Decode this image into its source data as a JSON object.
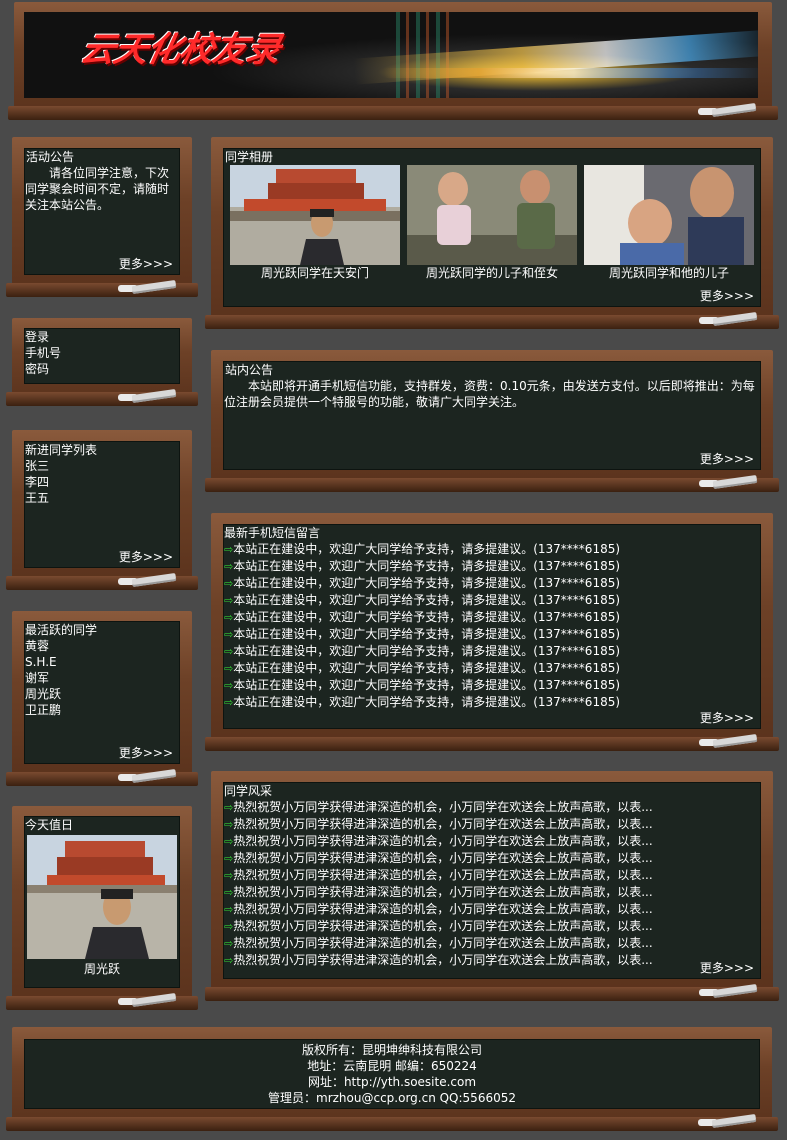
{
  "site": {
    "title": "云天化校友录"
  },
  "notice": {
    "title": "活动公告",
    "text": "请各位同学注意，下次同学聚会时间不定，请随时关注本站公告。",
    "more": "更多>>>"
  },
  "login": {
    "title": "登录",
    "phone_label": "手机号",
    "password_label": "密码"
  },
  "new_members": {
    "title": "新进同学列表",
    "items": [
      "张三",
      "李四",
      "王五"
    ],
    "more": "更多>>>"
  },
  "active": {
    "title": "最活跃的同学",
    "items": [
      "黄蓉",
      "S.H.E",
      "谢军",
      "周光跃",
      "卫正鹏"
    ],
    "more": "更多>>>"
  },
  "duty": {
    "title": "今天值日",
    "name": "周光跃"
  },
  "album": {
    "title": "同学相册",
    "photos": [
      {
        "caption": "周光跃同学在天安门"
      },
      {
        "caption": "周光跃同学的儿子和侄女"
      },
      {
        "caption": "周光跃同学和他的儿子"
      }
    ],
    "more": "更多>>>"
  },
  "site_notice": {
    "title": "站内公告",
    "text": "本站即将开通手机短信功能，支持群发，资费：0.10元条，由发送方支付。以后即将推出：为每位注册会员提供一个特服号的功能，敬请广大同学关注。",
    "more": "更多>>>"
  },
  "sms": {
    "title": "最新手机短信留言",
    "messages": [
      "本站正在建设中，欢迎广大同学给予支持，请多提建议。(137****6185)",
      "本站正在建设中，欢迎广大同学给予支持，请多提建议。(137****6185)",
      "本站正在建设中，欢迎广大同学给予支持，请多提建议。(137****6185)",
      "本站正在建设中，欢迎广大同学给予支持，请多提建议。(137****6185)",
      "本站正在建设中，欢迎广大同学给予支持，请多提建议。(137****6185)",
      "本站正在建设中，欢迎广大同学给予支持，请多提建议。(137****6185)",
      "本站正在建设中，欢迎广大同学给予支持，请多提建议。(137****6185)",
      "本站正在建设中，欢迎广大同学给予支持，请多提建议。(137****6185)",
      "本站正在建设中，欢迎广大同学给予支持，请多提建议。(137****6185)",
      "本站正在建设中，欢迎广大同学给予支持，请多提建议。(137****6185)"
    ],
    "more": "更多>>>"
  },
  "style": {
    "title": "同学风采",
    "items": [
      "热烈祝贺小万同学获得进津深造的机会，小万同学在欢送会上放声高歌，以表...",
      "热烈祝贺小万同学获得进津深造的机会，小万同学在欢送会上放声高歌，以表...",
      "热烈祝贺小万同学获得进津深造的机会，小万同学在欢送会上放声高歌，以表...",
      "热烈祝贺小万同学获得进津深造的机会，小万同学在欢送会上放声高歌，以表...",
      "热烈祝贺小万同学获得进津深造的机会，小万同学在欢送会上放声高歌，以表...",
      "热烈祝贺小万同学获得进津深造的机会，小万同学在欢送会上放声高歌，以表...",
      "热烈祝贺小万同学获得进津深造的机会，小万同学在欢送会上放声高歌，以表...",
      "热烈祝贺小万同学获得进津深造的机会，小万同学在欢送会上放声高歌，以表...",
      "热烈祝贺小万同学获得进津深造的机会，小万同学在欢送会上放声高歌，以表...",
      "热烈祝贺小万同学获得进津深造的机会，小万同学在欢送会上放声高歌，以表..."
    ],
    "more": "更多>>>"
  },
  "footer": {
    "copyright": "版权所有：昆明坤绅科技有限公司",
    "address": "地址：云南昆明 邮编：650224",
    "website": "网址：http://yth.soesite.com",
    "admin": "管理员：mrzhou@ccp.org.cn QQ:5566052"
  },
  "colors": {
    "board": "#6d4127",
    "chalkboard": "#1c2520",
    "arrow": "#33cc33",
    "banner_title": "#ff2a2a"
  }
}
